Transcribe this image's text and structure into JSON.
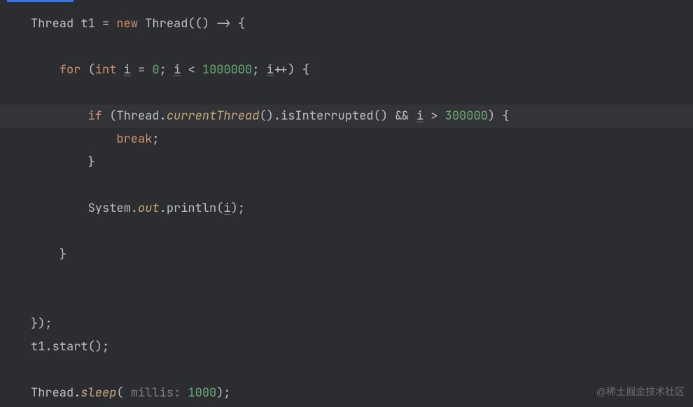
{
  "code": {
    "line1": {
      "type": "Thread",
      "var": "t1",
      "eq": " = ",
      "newKw": "new",
      "ctor": " Thread(() -> {"
    },
    "line2": "",
    "line3": {
      "forKw": "for",
      "open": " (",
      "intKw": "int",
      "sp": " ",
      "iVar": "i",
      "eq": " = ",
      "zero": "0",
      "semi1": "; ",
      "iVar2": "i",
      "lt": " < ",
      "million": "1000000",
      "semi2": "; ",
      "iVar3": "i",
      "inc": "++) {"
    },
    "line4": "",
    "line5": {
      "ifKw": "if",
      "open": " (Thread.",
      "curThread": "currentThread",
      "after": "().isInterrupted() && ",
      "iVar": "i",
      "gt": " > ",
      "num": "300000",
      "close": ") {"
    },
    "line6": {
      "breakKw": "break",
      "semi": ";"
    },
    "line7": "}",
    "line8": "",
    "line9": {
      "sys": "System.",
      "out": "out",
      "println": ".println(",
      "iVar": "i",
      "close": ");"
    },
    "line10": "",
    "line11": "}",
    "line12": "",
    "line13": "",
    "line14": "});",
    "line15": "t1.start();",
    "line16": "",
    "line17": {
      "thread": "Thread.",
      "sleep": "sleep",
      "open": "( ",
      "hint": "millis: ",
      "val": "1000",
      "close": ");"
    }
  },
  "watermark": "@稀土掘金技术社区"
}
